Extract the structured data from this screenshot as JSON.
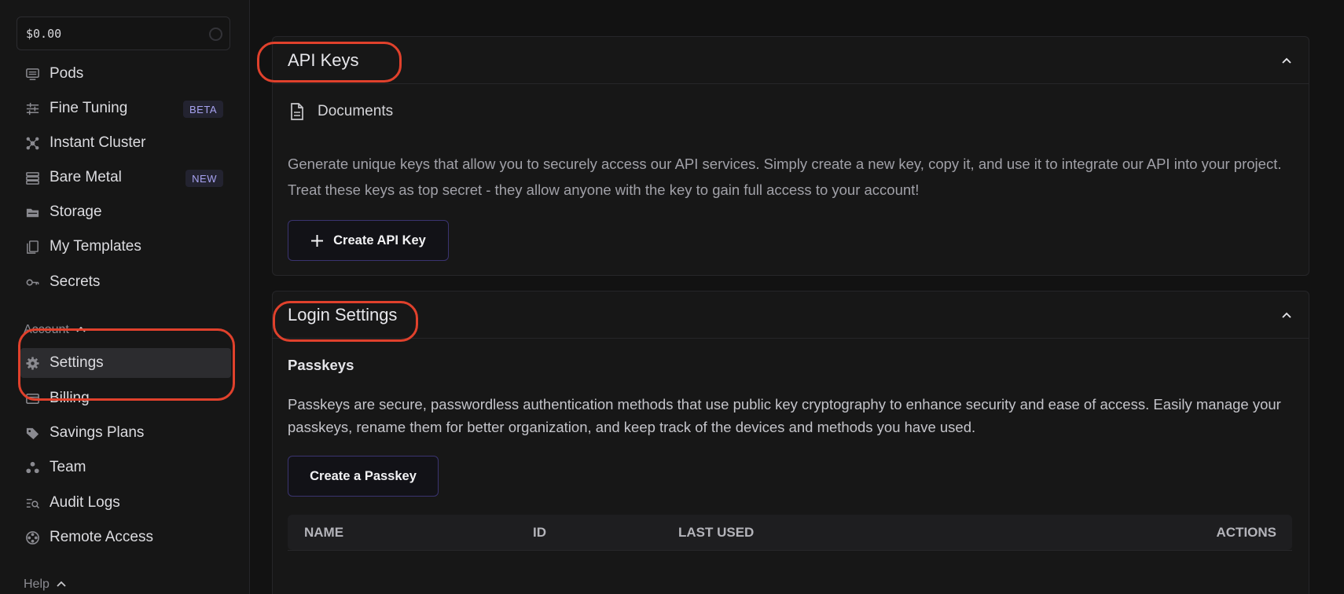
{
  "sidebar": {
    "balance": "$0.00",
    "items": [
      {
        "label": "Pods",
        "icon": "pods-icon"
      },
      {
        "label": "Fine Tuning",
        "icon": "sliders-icon",
        "badge": "BETA"
      },
      {
        "label": "Instant Cluster",
        "icon": "cluster-icon"
      },
      {
        "label": "Bare Metal",
        "icon": "server-icon",
        "badge": "NEW"
      },
      {
        "label": "Storage",
        "icon": "folder-icon"
      },
      {
        "label": "My Templates",
        "icon": "templates-icon"
      },
      {
        "label": "Secrets",
        "icon": "key-icon"
      }
    ],
    "account_label": "Account",
    "account_items": [
      {
        "label": "Settings",
        "icon": "gear-icon"
      },
      {
        "label": "Billing",
        "icon": "billing-icon"
      },
      {
        "label": "Savings Plans",
        "icon": "tag-icon"
      },
      {
        "label": "Team",
        "icon": "team-icon"
      },
      {
        "label": "Audit Logs",
        "icon": "audit-icon"
      },
      {
        "label": "Remote Access",
        "icon": "remote-icon"
      }
    ],
    "help_label": "Help"
  },
  "api_keys": {
    "title": "API Keys",
    "documents_label": "Documents",
    "description": "Generate unique keys that allow you to securely access our API services. Simply create a new key, copy it, and use it to integrate our API into your project. Treat these keys as top secret - they allow anyone with the key to gain full access to your account!",
    "create_button": "Create API Key"
  },
  "login_settings": {
    "title": "Login Settings",
    "passkeys_heading": "Passkeys",
    "passkeys_description": "Passkeys are secure, passwordless authentication methods that use public key cryptography to enhance security and ease of access. Easily manage your passkeys, rename them for better organization, and keep track of the devices and methods you have used.",
    "create_button": "Create a Passkey",
    "table_columns": [
      "NAME",
      "ID",
      "LAST USED",
      "ACTIONS"
    ]
  },
  "colors": {
    "accent": "#a7a2f0",
    "annotation": "#e0412c",
    "background": "#121212"
  }
}
